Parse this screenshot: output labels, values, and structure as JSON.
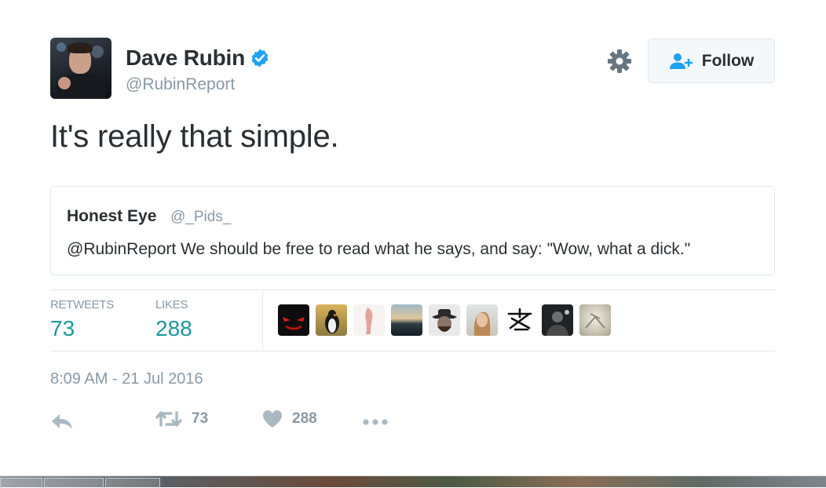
{
  "author": {
    "name": "Dave Rubin",
    "handle": "@RubinReport",
    "verified": true
  },
  "header": {
    "follow_label": "Follow"
  },
  "tweet": {
    "text": "It's really that simple."
  },
  "quote": {
    "name": "Honest Eye",
    "handle": "@_Pids_",
    "text": "@RubinReport We should be free to read what he says, and say: \"Wow, what a dick.\""
  },
  "stats": {
    "retweets_label": "RETWEETS",
    "retweets_value": "73",
    "likes_label": "LIKES",
    "likes_value": "288"
  },
  "likers": [
    {
      "icon": "red-eyes-avatar"
    },
    {
      "icon": "penguin-avatar"
    },
    {
      "icon": "figure-avatar"
    },
    {
      "icon": "sunset-landscape-avatar"
    },
    {
      "icon": "hat-man-avatar"
    },
    {
      "icon": "woman-portrait-avatar"
    },
    {
      "icon": "glyph-symbol-avatar"
    },
    {
      "icon": "dark-portrait-avatar"
    },
    {
      "icon": "light-abstract-avatar"
    }
  ],
  "timestamp": "8:09 AM - 21 Jul 2016",
  "actions": {
    "retweet_count": "73",
    "like_count": "288"
  },
  "colors": {
    "text": "#292f33",
    "muted": "#8899a6",
    "stat_value": "#1b95a0",
    "verified": "#1da1f2",
    "border": "#e1e8ed",
    "follow_icon": "#1da1f2"
  }
}
